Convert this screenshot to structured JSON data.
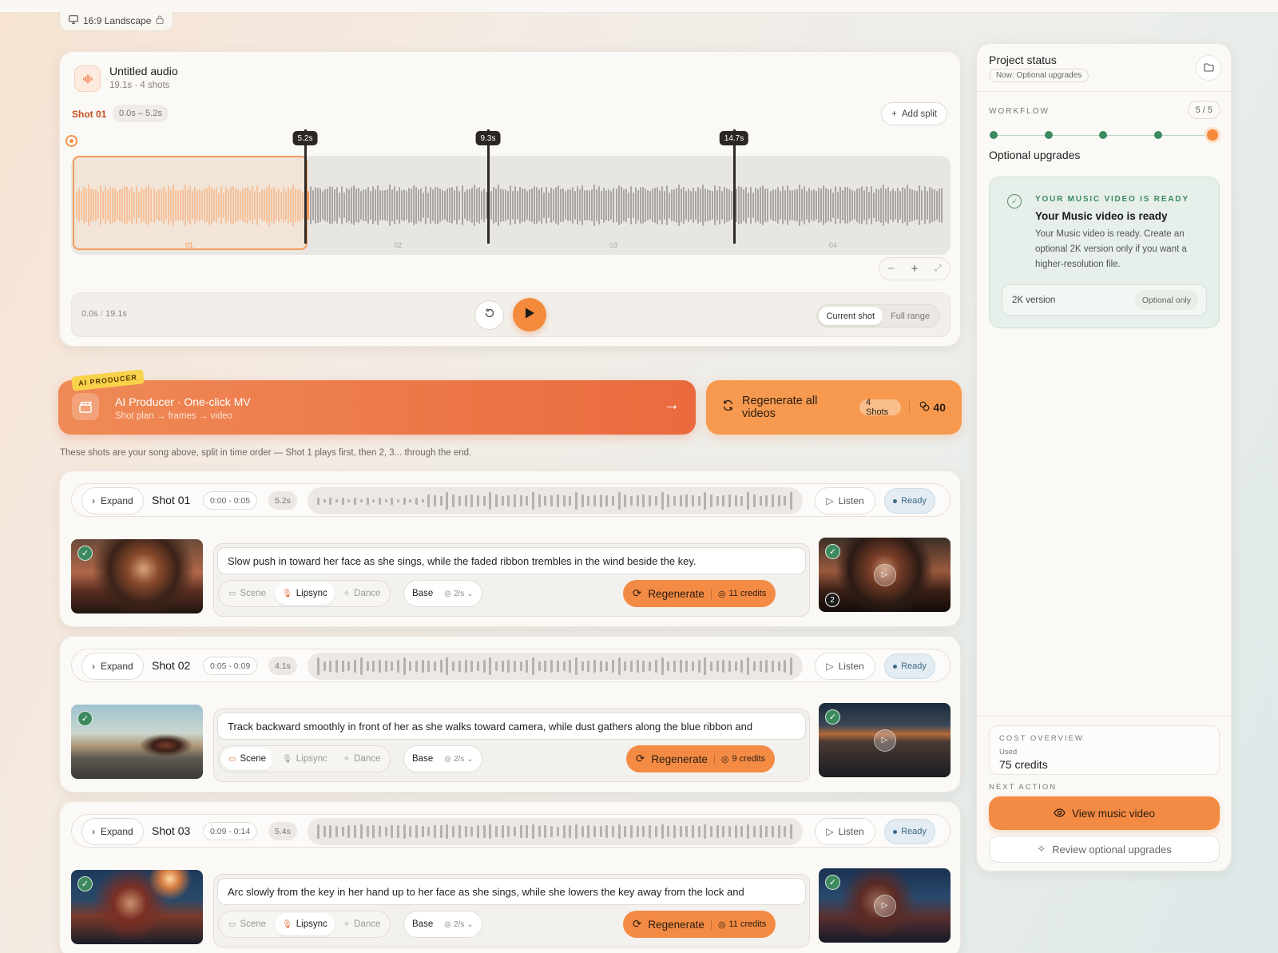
{
  "aspect": {
    "label": "16:9 Landscape"
  },
  "audio": {
    "title": "Untitled audio",
    "subtitle": "19.1s · 4 shots",
    "shot_label": "Shot 01",
    "shot_range": "0.0s – 5.2s",
    "add_split": "Add split",
    "markers": [
      "5.2s",
      "9.3s",
      "14.7s"
    ],
    "segments": [
      "01",
      "02",
      "03",
      "04"
    ],
    "time": "0.0s",
    "time_sep": "/",
    "duration": "19.1s",
    "range_options": [
      "Current shot",
      "Full range"
    ],
    "range_selected": "Current shot"
  },
  "producer": {
    "badge": "AI PRODUCER",
    "title": "AI Producer · One-click MV",
    "subtitle": "Shot plan → frames → video"
  },
  "regen_all": {
    "label": "Regenerate all videos",
    "shots": "4 Shots",
    "credits": "40"
  },
  "note": "These shots are your song above, split in time order — Shot 1 plays first, then 2, 3... through the end.",
  "shots": [
    {
      "expand": "Expand",
      "name": "Shot 01",
      "time": "0:00 - 0:05",
      "duration": "5.2s",
      "listen": "Listen",
      "status": "Ready",
      "prompt": "Slow push in toward her face as she sings, while the faded ribbon trembles in the wind beside the key.",
      "modes": [
        "Scene",
        "Lipsync",
        "Dance"
      ],
      "active_mode": "Lipsync",
      "base": "Base",
      "rate": "2/s",
      "regenerate": "Regenerate",
      "credits": "11 credits",
      "version": "2"
    },
    {
      "expand": "Expand",
      "name": "Shot 02",
      "time": "0:05 - 0:09",
      "duration": "4.1s",
      "listen": "Listen",
      "status": "Ready",
      "prompt": "Track backward smoothly in front of her as she walks toward camera, while dust gathers along the blue ribbon and",
      "modes": [
        "Scene",
        "Lipsync",
        "Dance"
      ],
      "active_mode": "Scene",
      "base": "Base",
      "rate": "2/s",
      "regenerate": "Regenerate",
      "credits": "9 credits"
    },
    {
      "expand": "Expand",
      "name": "Shot 03",
      "time": "0:09 - 0:14",
      "duration": "5.4s",
      "listen": "Listen",
      "status": "Ready",
      "prompt": "Arc slowly from the key in her hand up to her face as she sings, while she lowers the key away from the lock and",
      "modes": [
        "Scene",
        "Lipsync",
        "Dance"
      ],
      "active_mode": "Lipsync",
      "base": "Base",
      "rate": "2/s",
      "regenerate": "Regenerate",
      "credits": "11 credits"
    }
  ],
  "side": {
    "title": "Project status",
    "now": "Now: Optional upgrades",
    "workflow_label": "WORKFLOW",
    "workflow_count": "5 / 5",
    "steps_total": 5,
    "steps_current": 5,
    "stage": "Optional upgrades",
    "ready_eyebrow": "YOUR MUSIC VIDEO IS READY",
    "ready_title": "Your Music video is ready",
    "ready_body": "Your Music video is ready. Create an optional 2K version only if you want a higher-resolution file.",
    "option_label": "2K version",
    "option_tag": "Optional only",
    "cost_label": "COST OVERVIEW",
    "cost_used_label": "Used",
    "cost_used": "75 credits",
    "next_label": "NEXT ACTION",
    "view_button": "View music video",
    "review_button": "Review optional upgrades"
  },
  "colors": {
    "accent": "#f48b44",
    "success": "#3d8a5f",
    "ready": "#3e6a85"
  }
}
